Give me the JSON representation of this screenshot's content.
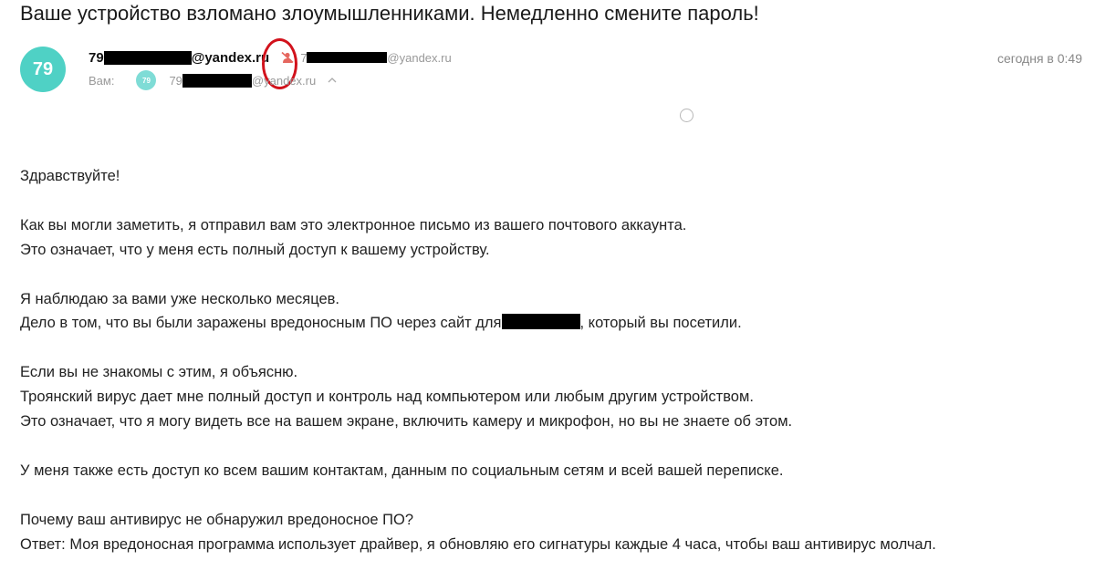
{
  "message": {
    "subject": "Ваше устройство взломано злоумышленниками. Немедленно смените пароль!",
    "sender": {
      "avatar_text": "79",
      "email_prefix": "79",
      "email_suffix": "@yandex.ru",
      "reply_prefix": "7",
      "reply_suffix": "@yandex.ru"
    },
    "recipient": {
      "label": "Вам:",
      "avatar_text": "79",
      "email_prefix": "79",
      "email_suffix": "@yandex.ru"
    },
    "date": "сегодня в 0:49",
    "icons": {
      "spoof": "crossed-person-icon",
      "expand": "chevron-up-icon",
      "select": "radio-circle-icon"
    },
    "colors": {
      "avatar": "#4fd1c5",
      "highlight_ring": "#d2121c",
      "spoof_icon": "#e5675f"
    },
    "body": {
      "greeting": "Здравствуйте!",
      "p1_l1": "Как вы могли заметить, я отправил вам это электронное письмо из вашего почтового аккаунта.",
      "p1_l2": "Это означает, что у меня есть полный доступ к вашему устройству.",
      "p2_l1": "Я наблюдаю за вами уже несколько месяцев.",
      "p2_l2_before": "Дело в том, что вы были заражены вредоносным ПО через сайт для",
      "p2_l2_after": ", который вы посетили.",
      "p3_l1": "Если вы не знакомы с этим, я объясню.",
      "p3_l2": "Троянский вирус дает мне полный доступ и контроль над компьютером или любым другим устройством.",
      "p3_l3": "Это означает, что я могу видеть все на вашем экране, включить камеру и микрофон, но вы не знаете об этом.",
      "p4_l1": "У меня также есть доступ ко всем вашим контактам, данным по социальным сетям и всей вашей переписке.",
      "p5_l1": "Почему ваш антивирус не обнаружил вредоносное ПО?",
      "p5_l2": "Ответ: Моя вредоносная программа использует драйвер, я обновляю его сигнатуры каждые 4 часа, чтобы ваш антивирус молчал."
    }
  }
}
